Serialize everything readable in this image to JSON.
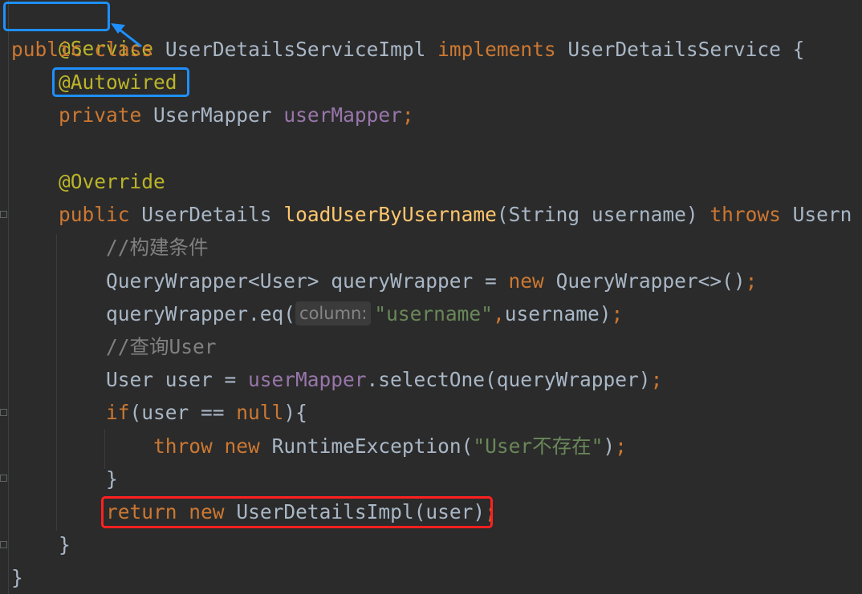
{
  "code": {
    "line1": {
      "annotation": "@Service"
    },
    "line2": {
      "kw_public": "public",
      "kw_class": "class",
      "class_name": "UserDetailsServiceImpl",
      "kw_implements": "implements",
      "interface_name": "UserDetailsService",
      "brace": "{"
    },
    "line3": {
      "annotation": "@Autowired"
    },
    "line4": {
      "kw_private": "private",
      "type": "UserMapper",
      "field": "userMapper",
      "semicolon": ";"
    },
    "line6": {
      "annotation": "@Override"
    },
    "line7": {
      "kw_public": "public",
      "return_type": "UserDetails",
      "method": "loadUserByUsername",
      "params": "(String username)",
      "kw_throws": "throws",
      "exception": "Usern"
    },
    "line8": {
      "comment": "//构建条件"
    },
    "line9": {
      "decl": "QueryWrapper<User> queryWrapper = ",
      "kw_new": "new",
      "ctor": "QueryWrapper<>()",
      "semicolon": ";"
    },
    "line10": {
      "call": "queryWrapper.eq(",
      "hint": "column:",
      "string": "\"username\"",
      "comma": ",",
      "rest": "username)",
      "semicolon": ";"
    },
    "line11": {
      "comment": "//查询User"
    },
    "line12": {
      "decl": "User user = ",
      "field": "userMapper",
      "call": ".selectOne(queryWrapper)",
      "semicolon": ";"
    },
    "line13": {
      "kw_if": "if",
      "cond_open": "(user == ",
      "kw_null": "null",
      "cond_close": "){"
    },
    "line14": {
      "kw_throw": "throw",
      "kw_new": "new",
      "ctor": "RuntimeException(",
      "string": "\"User不存在\"",
      "close": ")",
      "semicolon": ";"
    },
    "line15": {
      "brace": "}"
    },
    "line16": {
      "kw_return": "return",
      "kw_new": "new",
      "ctor": "UserDetailsImpl(user)",
      "semicolon": ";"
    },
    "line17": {
      "brace": "}"
    },
    "line18": {
      "brace": "}"
    }
  },
  "colors": {
    "background": "#2b2b2b",
    "keyword": "#cc7832",
    "annotation": "#bbb529",
    "field": "#9876aa",
    "method": "#ffc66d",
    "string": "#6a8759",
    "comment": "#808080",
    "text": "#a9b7c6",
    "highlight_blue": "#1e90ff",
    "highlight_red": "#ff2020"
  }
}
